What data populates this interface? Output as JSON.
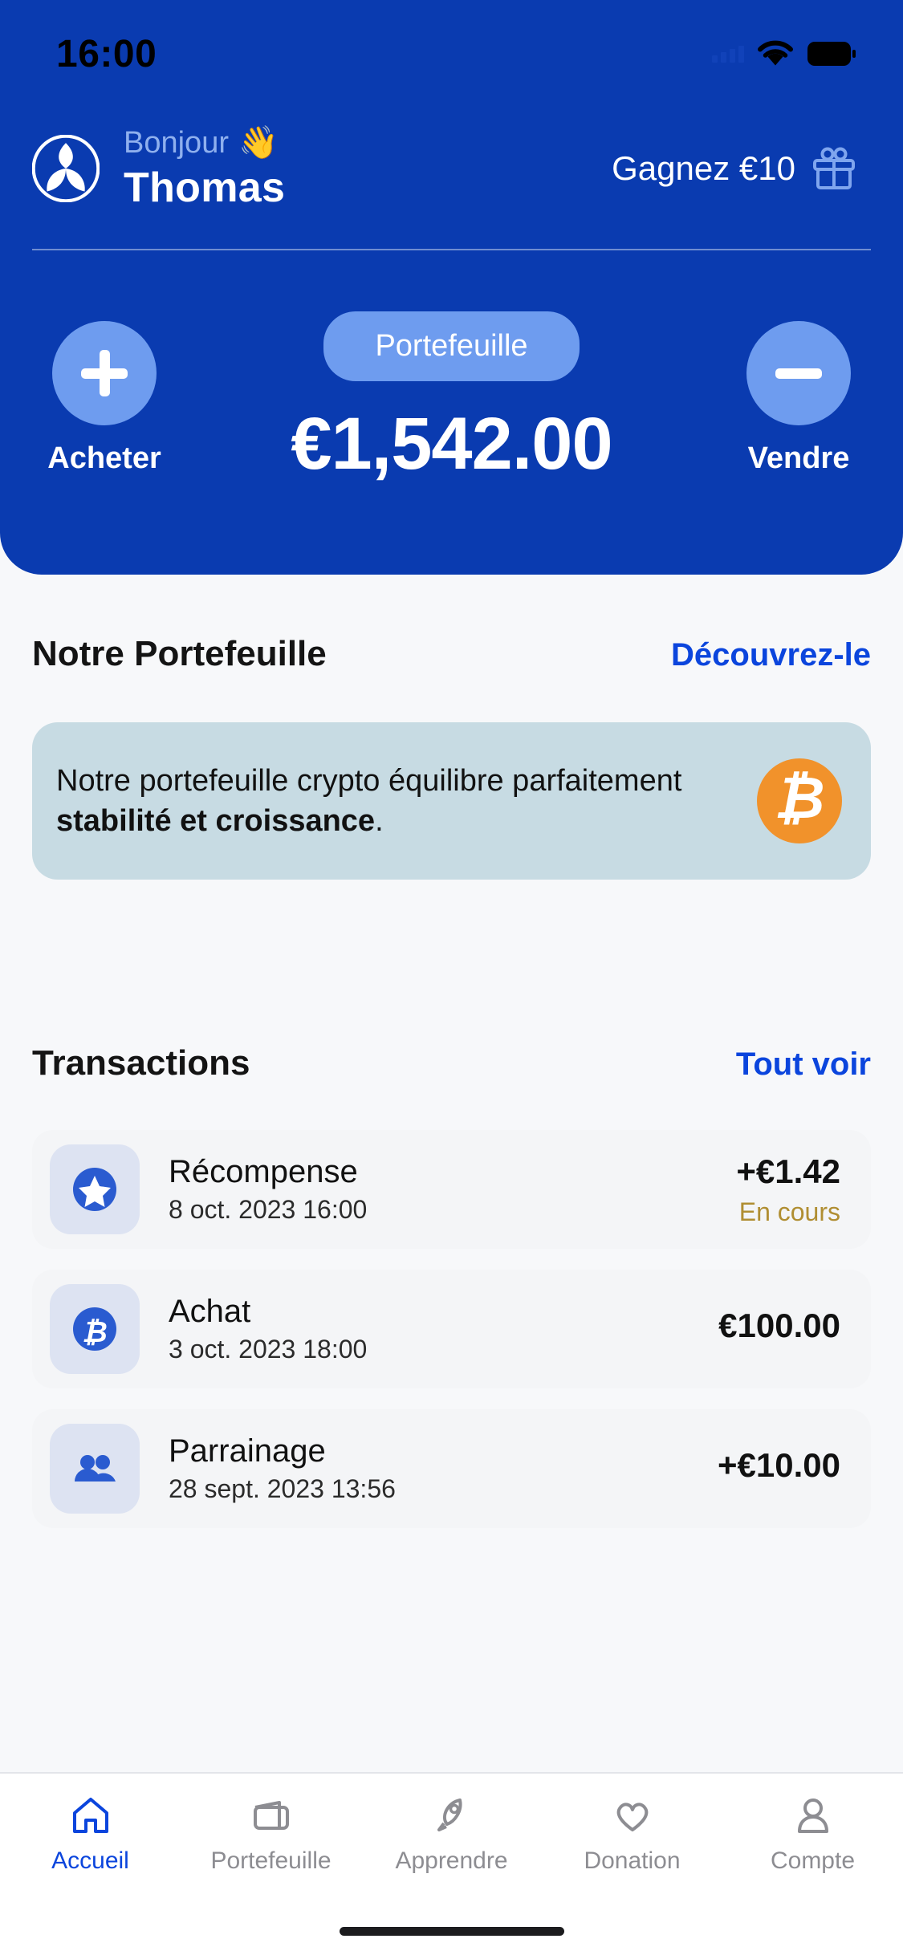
{
  "status_bar": {
    "time": "16:00",
    "wifi_icon": "wifi-icon",
    "battery_icon": "battery-icon",
    "signal_icon": "signal-bars-icon"
  },
  "header": {
    "logo_icon": "app-logo-icon",
    "greeting": "Bonjour",
    "wave_emoji": "👋",
    "user_name": "Thomas",
    "earn_label": "Gagnez €10",
    "gift_icon": "gift-icon",
    "background_color": "#0a3bb0"
  },
  "balance": {
    "buy": {
      "label": "Acheter",
      "icon": "plus-icon"
    },
    "sell": {
      "label": "Vendre",
      "icon": "minus-icon"
    },
    "pill_label": "Portefeuille",
    "amount": "€1,542.00",
    "accent_color": "#6e9cef"
  },
  "portfolio_section": {
    "title": "Notre Portefeuille",
    "link": "Découvrez-le",
    "promo": {
      "text_before": "Notre portefeuille crypto équilibre parfaitement ",
      "text_bold": "stabilité et croissance",
      "text_after": ".",
      "coin_icon": "bitcoin-icon",
      "coin_symbol": "₿",
      "coin_color": "#f1922b",
      "card_color": "#c7dbe3"
    }
  },
  "transactions_section": {
    "title": "Transactions",
    "link": "Tout voir",
    "items": [
      {
        "icon": "star-badge-icon",
        "title": "Récompense",
        "date": "8 oct. 2023 16:00",
        "amount": "+€1.42",
        "status": "En cours",
        "status_color": "#b08e32"
      },
      {
        "icon": "bitcoin-badge-icon",
        "title": "Achat",
        "date": "3 oct. 2023 18:00",
        "amount": "€100.00",
        "status": "",
        "status_color": ""
      },
      {
        "icon": "people-badge-icon",
        "title": "Parrainage",
        "date": "28 sept. 2023 13:56",
        "amount": "+€10.00",
        "status": "",
        "status_color": ""
      }
    ]
  },
  "tabbar": {
    "active_color": "#0b45dd",
    "inactive_color": "#8d8d92",
    "items": [
      {
        "label": "Accueil",
        "icon": "home-icon",
        "active": true
      },
      {
        "label": "Portefeuille",
        "icon": "wallet-icon",
        "active": false
      },
      {
        "label": "Apprendre",
        "icon": "rocket-icon",
        "active": false
      },
      {
        "label": "Donation",
        "icon": "heart-icon",
        "active": false
      },
      {
        "label": "Compte",
        "icon": "person-icon",
        "active": false
      }
    ]
  }
}
